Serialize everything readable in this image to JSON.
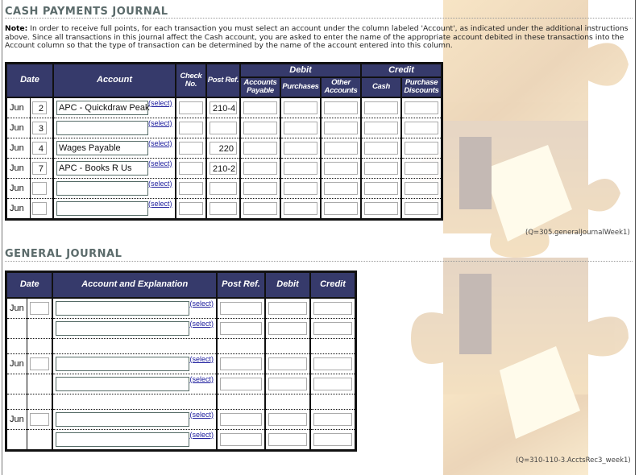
{
  "cash_payments": {
    "title": "CASH PAYMENTS JOURNAL",
    "note_label": "Note:",
    "note_text": " In order to receive full points, for each transaction you must select an account under the column labeled 'Account', as indicated under the additional instructions above. Since all transactions in this journal affect the Cash account, you are asked to enter the name of the appropriate account debited in these transactions into the Account column so that the type of transaction can be determined by the name of the account entered into this column.",
    "headers": {
      "date": "Date",
      "account": "Account",
      "check_no": "Check No.",
      "post_ref": "Post Ref.",
      "debit": "Debit",
      "credit": "Credit",
      "accounts_payable": "Accounts Payable",
      "purchases": "Purchases",
      "other_accounts": "Other Accounts",
      "cash": "Cash",
      "purchase_discounts": "Purchase Discounts"
    },
    "select_label": "(select)",
    "rows": [
      {
        "month": "Jun",
        "day": "2",
        "account": "APC - Quickdraw Peak",
        "check_no": "",
        "post_ref": "210-4",
        "accounts_payable": "",
        "purchases": "",
        "other_accounts": "",
        "cash": "",
        "purchase_discounts": ""
      },
      {
        "month": "Jun",
        "day": "3",
        "account": "",
        "check_no": "",
        "post_ref": "",
        "accounts_payable": "",
        "purchases": "",
        "other_accounts": "",
        "cash": "",
        "purchase_discounts": ""
      },
      {
        "month": "Jun",
        "day": "4",
        "account": "Wages Payable",
        "check_no": "",
        "post_ref": "220",
        "accounts_payable": "",
        "purchases": "",
        "other_accounts": "",
        "cash": "",
        "purchase_discounts": ""
      },
      {
        "month": "Jun",
        "day": "7",
        "account": "APC - Books R Us",
        "check_no": "",
        "post_ref": "210-2",
        "accounts_payable": "",
        "purchases": "",
        "other_accounts": "",
        "cash": "",
        "purchase_discounts": ""
      },
      {
        "month": "Jun",
        "day": "",
        "account": "",
        "check_no": "",
        "post_ref": "",
        "accounts_payable": "",
        "purchases": "",
        "other_accounts": "",
        "cash": "",
        "purchase_discounts": ""
      },
      {
        "month": "Jun",
        "day": "",
        "account": "",
        "check_no": "",
        "post_ref": "",
        "accounts_payable": "",
        "purchases": "",
        "other_accounts": "",
        "cash": "",
        "purchase_discounts": ""
      }
    ],
    "question_ref": "(Q=305.generalJournalWeek1)"
  },
  "general_journal": {
    "title": "GENERAL JOURNAL",
    "headers": {
      "date": "Date",
      "account_explanation": "Account and Explanation",
      "post_ref": "Post Ref.",
      "debit": "Debit",
      "credit": "Credit"
    },
    "select_label": "(select)",
    "entries": [
      {
        "month": "Jun",
        "day": "",
        "lines": [
          {
            "account": "",
            "post_ref": "",
            "debit": "",
            "credit": ""
          },
          {
            "account": "",
            "post_ref": "",
            "debit": "",
            "credit": ""
          }
        ]
      },
      {
        "month": "Jun",
        "day": "",
        "lines": [
          {
            "account": "",
            "post_ref": "",
            "debit": "",
            "credit": ""
          },
          {
            "account": "",
            "post_ref": "",
            "debit": "",
            "credit": ""
          }
        ]
      },
      {
        "month": "Jun",
        "day": "",
        "lines": [
          {
            "account": "",
            "post_ref": "",
            "debit": "",
            "credit": ""
          },
          {
            "account": "",
            "post_ref": "",
            "debit": "",
            "credit": ""
          }
        ]
      }
    ],
    "question_ref": "(Q=310-110-3.AcctsRec3_week1)"
  }
}
